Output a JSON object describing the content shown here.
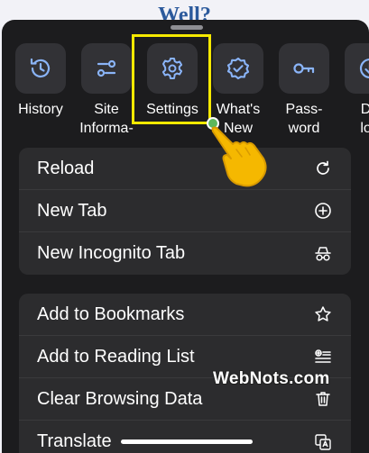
{
  "background": {
    "title": "Well?"
  },
  "quick_actions": [
    {
      "label": "History",
      "icon": "history-icon"
    },
    {
      "label": "Site\nInforma-",
      "icon": "site-info-icon"
    },
    {
      "label": "Settings",
      "icon": "gear-icon"
    },
    {
      "label": "What's\nNew",
      "icon": "badge-check-icon"
    },
    {
      "label": "Pass-\nword",
      "icon": "key-icon"
    },
    {
      "label": "Do\nloa",
      "icon": "download-icon"
    }
  ],
  "menu_group_1": [
    {
      "label": "Reload",
      "icon": "reload-icon"
    },
    {
      "label": "New Tab",
      "icon": "plus-circle-icon"
    },
    {
      "label": "New Incognito Tab",
      "icon": "incognito-icon"
    }
  ],
  "menu_group_2": [
    {
      "label": "Add to Bookmarks",
      "icon": "star-icon"
    },
    {
      "label": "Add to Reading List",
      "icon": "reading-list-icon"
    },
    {
      "label": "Clear Browsing Data",
      "icon": "trash-icon"
    },
    {
      "label": "Translate",
      "icon": "translate-icon"
    }
  ],
  "watermark": "WebNots.com",
  "colors": {
    "highlight": "#f5e900",
    "sheet": "#1c1c1e",
    "icon": "#8ab4f8",
    "hand": "#f5b800"
  }
}
